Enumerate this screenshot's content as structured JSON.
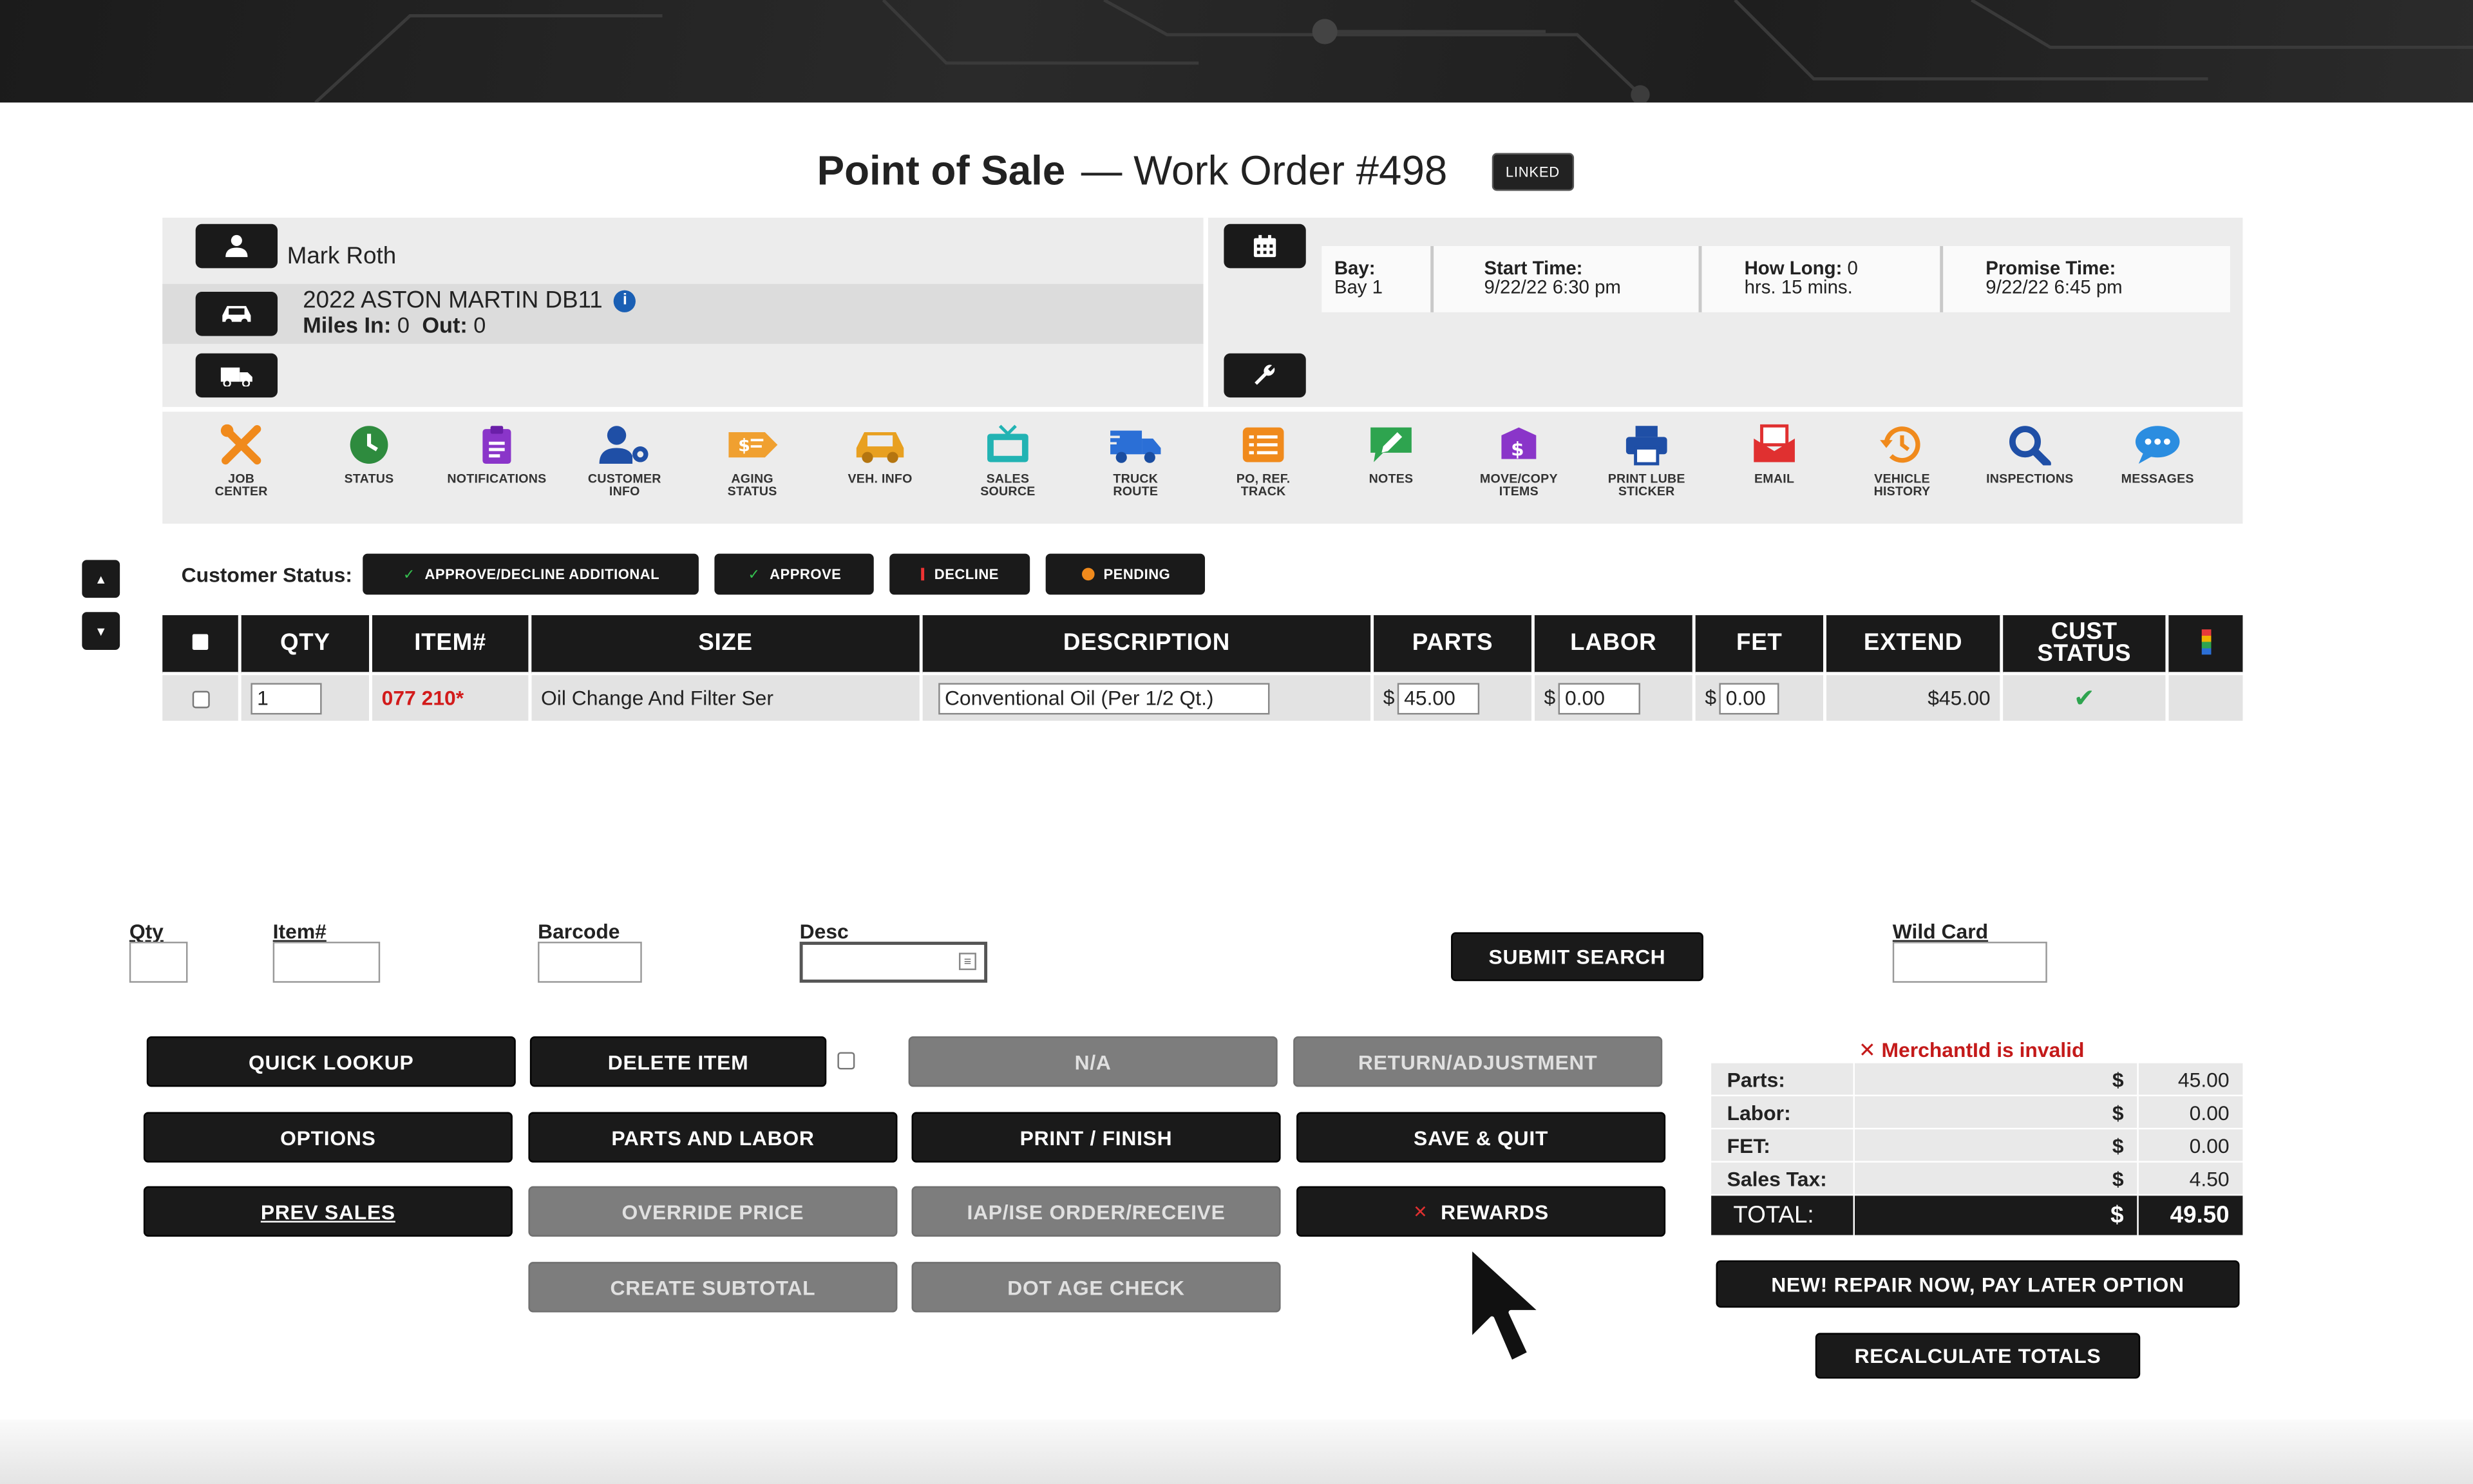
{
  "header": {
    "title_bold": "Point of Sale",
    "title_rest": "— Work Order #498",
    "linked_badge": "LINKED"
  },
  "customer": {
    "name": "Mark Roth",
    "vehicle": "2022 ASTON MARTIN DB11",
    "miles_in_label": "Miles In:",
    "miles_in": "0",
    "miles_out_label": "Out:",
    "miles_out": "0"
  },
  "schedule": {
    "bay_label": "Bay:",
    "bay": "Bay 1",
    "start_label": "Start Time:",
    "start": "9/22/22 6:30 pm",
    "how_long_label": "How Long:",
    "how_long_a": "0",
    "how_long_b": "hrs. 15 mins.",
    "promise_label": "Promise Time:",
    "promise": "9/22/22 6:45 pm"
  },
  "toolbar": [
    {
      "label": "JOB\nCENTER",
      "icon": "tools-icon",
      "color": "#f08a1c"
    },
    {
      "label": "STATUS",
      "icon": "clock-icon",
      "color": "#2e8b3e"
    },
    {
      "label": "NOTIFICATIONS",
      "icon": "clipboard-icon",
      "color": "#8a35c9"
    },
    {
      "label": "CUSTOMER\nINFO",
      "icon": "user-gear-icon",
      "color": "#1f4fa6"
    },
    {
      "label": "AGING\nSTATUS",
      "icon": "money-tag-icon",
      "color": "#f0a030"
    },
    {
      "label": "VEH. INFO",
      "icon": "car-icon",
      "color": "#e8a020"
    },
    {
      "label": "SALES\nSOURCE",
      "icon": "tv-icon",
      "color": "#22b3b3"
    },
    {
      "label": "TRUCK\nROUTE",
      "icon": "truck-icon",
      "color": "#2b6fd6"
    },
    {
      "label": "PO, REF.\nTRACK",
      "icon": "list-icon",
      "color": "#f08a1c"
    },
    {
      "label": "NOTES",
      "icon": "note-icon",
      "color": "#2ea44f"
    },
    {
      "label": "MOVE/COPY\nITEMS",
      "icon": "box-dollar-icon",
      "color": "#8a35c9"
    },
    {
      "label": "PRINT LUBE\nSTICKER",
      "icon": "printer-icon",
      "color": "#1f4fa6"
    },
    {
      "label": "EMAIL",
      "icon": "envelope-icon",
      "color": "#e03030"
    },
    {
      "label": "VEHICLE\nHISTORY",
      "icon": "history-icon",
      "color": "#f08a1c"
    },
    {
      "label": "INSPECTIONS",
      "icon": "magnifier-icon",
      "color": "#1f4fa6"
    },
    {
      "label": "MESSAGES",
      "icon": "chat-icon",
      "color": "#2b8de0"
    }
  ],
  "customer_status": {
    "label": "Customer Status:",
    "approve_decline": "APPROVE/DECLINE ADDITIONAL",
    "approve": "APPROVE",
    "decline": "DECLINE",
    "pending": "PENDING"
  },
  "table": {
    "headers": {
      "qty": "QTY",
      "item": "ITEM#",
      "size": "SIZE",
      "description": "DESCRIPTION",
      "parts": "PARTS",
      "labor": "LABOR",
      "fet": "FET",
      "extend": "EXTEND",
      "cust_status": "CUST\nSTATUS"
    },
    "rows": [
      {
        "qty": "1",
        "item": "077 210*",
        "size": "Oil Change And Filter Ser",
        "description": "Conventional Oil (Per 1/2 Qt.)",
        "parts_sym": "$",
        "parts": "45.00",
        "labor_sym": "$",
        "labor": "0.00",
        "fet_sym": "$",
        "fet": "0.00",
        "extend": "$45.00"
      }
    ]
  },
  "search": {
    "qty_label": "Qty",
    "item_label": "Item#",
    "barcode_label": "Barcode",
    "desc_label": "Desc",
    "wildcard_label": "Wild Card",
    "submit": "SUBMIT SEARCH"
  },
  "buttons": {
    "quick_lookup": "QUICK LOOKUP",
    "delete_item": "DELETE ITEM",
    "na": "N/A",
    "return_adjustment": "RETURN/ADJUSTMENT",
    "options": "OPTIONS",
    "parts_and_labor": "PARTS AND LABOR",
    "print_finish": "PRINT / FINISH",
    "save_quit": "SAVE & QUIT",
    "prev_sales": "PREV SALES",
    "override_price": "OVERRIDE PRICE",
    "iap_ise": "IAP/ISE ORDER/RECEIVE",
    "rewards": "REWARDS",
    "create_subtotal": "CREATE SUBTOTAL",
    "dot_age_check": "DOT AGE CHECK",
    "repair_now": "NEW! REPAIR NOW, PAY LATER OPTION",
    "recalculate": "RECALCULATE TOTALS"
  },
  "totals": {
    "error": "✕ MerchantId is invalid",
    "rows": [
      {
        "label": "Parts:",
        "sym": "$",
        "value": "45.00"
      },
      {
        "label": "Labor:",
        "sym": "$",
        "value": "0.00"
      },
      {
        "label": "FET:",
        "sym": "$",
        "value": "0.00"
      },
      {
        "label": "Sales Tax:",
        "sym": "$",
        "value": "4.50"
      }
    ],
    "total_label": "TOTAL:",
    "total_sym": "$",
    "total_value": "49.50"
  },
  "colors": {
    "dark": "#1a1a1a",
    "disabled": "#7d7d7d",
    "error_red": "#c41a1a",
    "item_red": "#d21b1b"
  }
}
